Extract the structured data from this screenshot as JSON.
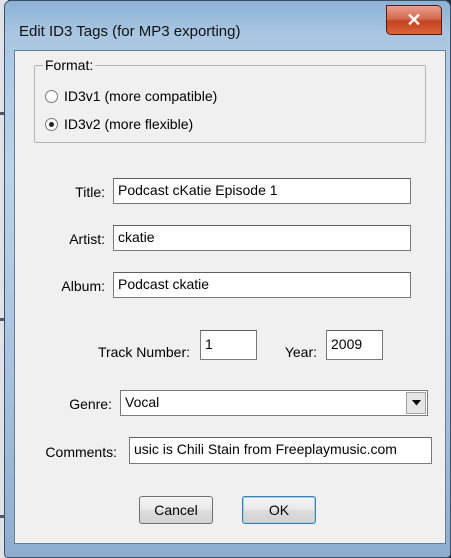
{
  "window": {
    "title": "Edit ID3 Tags (for MP3 exporting)",
    "close_glyph": "✕"
  },
  "format": {
    "group_label": "Format:",
    "options": [
      {
        "label": "ID3v1 (more compatible)",
        "selected": false
      },
      {
        "label": "ID3v2 (more flexible)",
        "selected": true
      }
    ]
  },
  "fields": {
    "title_label": "Title:",
    "title_value": "Podcast cKatie Episode 1",
    "artist_label": "Artist:",
    "artist_value": "ckatie",
    "album_label": "Album:",
    "album_value": "Podcast ckatie",
    "track_label": "Track Number:",
    "track_value": "1",
    "year_label": "Year:",
    "year_value": "2009",
    "genre_label": "Genre:",
    "genre_value": "Vocal",
    "comments_label": "Comments:",
    "comments_value": "usic is Chili Stain from Freeplaymusic.com"
  },
  "buttons": {
    "cancel": "Cancel",
    "ok": "OK"
  },
  "colors": {
    "accent_close": "#c4421f",
    "client_bg": "#f0f0f0"
  }
}
